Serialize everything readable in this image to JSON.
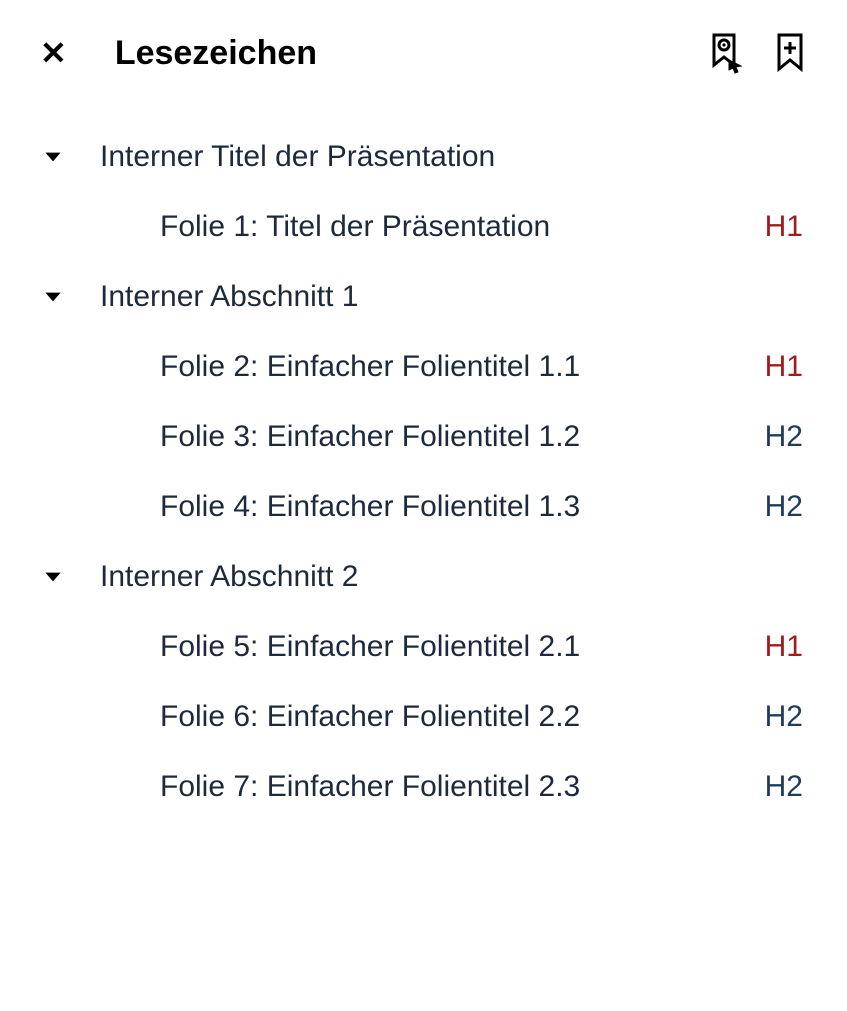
{
  "header": {
    "title": "Lesezeichen"
  },
  "sections": [
    {
      "label": "Interner Titel der Präsentation",
      "items": [
        {
          "label": "Folie 1: Titel der Präsentation",
          "level": "H1",
          "levelClass": "level-h1"
        }
      ]
    },
    {
      "label": "Interner Abschnitt 1",
      "items": [
        {
          "label": "Folie 2: Einfacher Folientitel 1.1",
          "level": "H1",
          "levelClass": "level-h1"
        },
        {
          "label": "Folie 3: Einfacher Folientitel 1.2",
          "level": "H2",
          "levelClass": "level-h2"
        },
        {
          "label": "Folie 4: Einfacher Folientitel 1.3",
          "level": "H2",
          "levelClass": "level-h2"
        }
      ]
    },
    {
      "label": "Interner Abschnitt 2",
      "items": [
        {
          "label": "Folie 5: Einfacher Folientitel 2.1",
          "level": "H1",
          "levelClass": "level-h1"
        },
        {
          "label": "Folie 6: Einfacher Folientitel 2.2",
          "level": "H2",
          "levelClass": "level-h2"
        },
        {
          "label": "Folie 7: Einfacher Folientitel 2.3",
          "level": "H2",
          "levelClass": "level-h2"
        }
      ]
    }
  ]
}
